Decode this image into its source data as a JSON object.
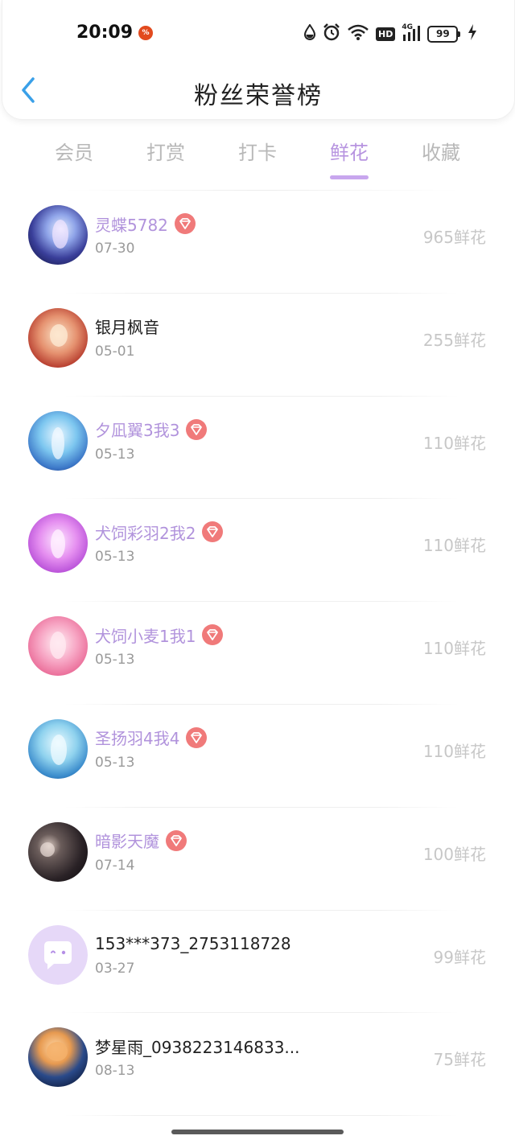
{
  "status_bar": {
    "time": "20:09",
    "notification_icon": "app-notification-icon",
    "network_label": "4G",
    "hd_label": "HD",
    "battery_level": "99"
  },
  "header": {
    "title": "粉丝荣誉榜",
    "back_icon": "chevron-left-icon"
  },
  "tabs": [
    {
      "label": "会员",
      "active": false
    },
    {
      "label": "打赏",
      "active": false
    },
    {
      "label": "打卡",
      "active": false
    },
    {
      "label": "鲜花",
      "active": true
    },
    {
      "label": "收藏",
      "active": false
    }
  ],
  "colors": {
    "accent": "#b794e0",
    "vip_name": "#b193dc",
    "badge": "#f07a7a",
    "count": "#c7c7c7"
  },
  "fans": [
    {
      "name": "灵蝶5782",
      "date": "07-30",
      "count": "965鲜花",
      "vip": true
    },
    {
      "name": "银月枫音",
      "date": "05-01",
      "count": "255鲜花",
      "vip": false
    },
    {
      "name": "夕凪翼3我3",
      "date": "05-13",
      "count": "110鲜花",
      "vip": true
    },
    {
      "name": "犬饲彩羽2我2",
      "date": "05-13",
      "count": "110鲜花",
      "vip": true
    },
    {
      "name": "犬饲小麦1我1",
      "date": "05-13",
      "count": "110鲜花",
      "vip": true
    },
    {
      "name": "圣扬羽4我4",
      "date": "05-13",
      "count": "110鲜花",
      "vip": true
    },
    {
      "name": "暗影天魔",
      "date": "07-14",
      "count": "100鲜花",
      "vip": true
    },
    {
      "name": "153***373_2753118728",
      "date": "03-27",
      "count": "99鲜花",
      "vip": false
    },
    {
      "name": "梦星雨_0938223146833...",
      "date": "08-13",
      "count": "75鲜花",
      "vip": false
    }
  ]
}
